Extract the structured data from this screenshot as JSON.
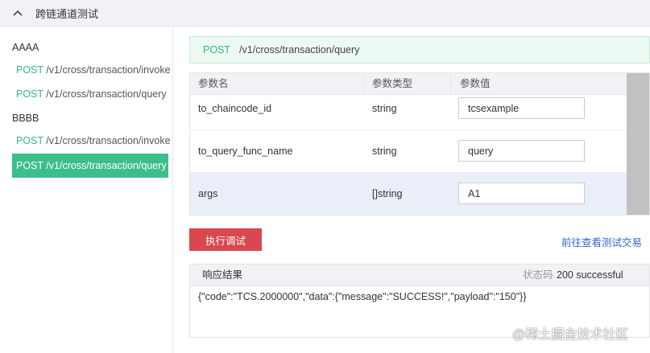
{
  "header": {
    "title": "跨链通道测试",
    "collapse_icon": "chevron-up-icon"
  },
  "sidebar": {
    "groups": [
      {
        "title": "AAAA",
        "items": [
          {
            "method": "POST",
            "path": "/v1/cross/transaction/invoke"
          },
          {
            "method": "POST",
            "path": "/v1/cross/transaction/query"
          }
        ]
      },
      {
        "title": "BBBB",
        "items": [
          {
            "method": "POST",
            "path": "/v1/cross/transaction/invoke"
          },
          {
            "method": "POST",
            "path": "/v1/cross/transaction/query",
            "active": true
          }
        ]
      }
    ]
  },
  "api": {
    "method": "POST",
    "path": "/v1/cross/transaction/query"
  },
  "params": {
    "headers": [
      "参数名",
      "参数类型",
      "参数值"
    ],
    "rows": [
      {
        "name": "to_chaincode_id",
        "type": "string",
        "value": "tcsexample"
      },
      {
        "name": "to_query_func_name",
        "type": "string",
        "value": "query"
      },
      {
        "name": "args",
        "type": "[]string",
        "value": "A1"
      }
    ]
  },
  "actions": {
    "run_label": "执行调试",
    "view_tx_label": "前往查看测试交易"
  },
  "response": {
    "title": "响应结果",
    "status_label": "状态码",
    "status_value": "200 successful",
    "body": "{\"code\":\"TCS.2000000\",\"data\":{\"message\":\"SUCCESS!\",\"payload\":\"150\"}}"
  },
  "watermark": "@稀土掘金技术社区",
  "colors": {
    "accent_green": "#3cbe8c",
    "method_green": "#32b97a",
    "danger_red": "#d9484f",
    "link_blue": "#3467c9"
  }
}
